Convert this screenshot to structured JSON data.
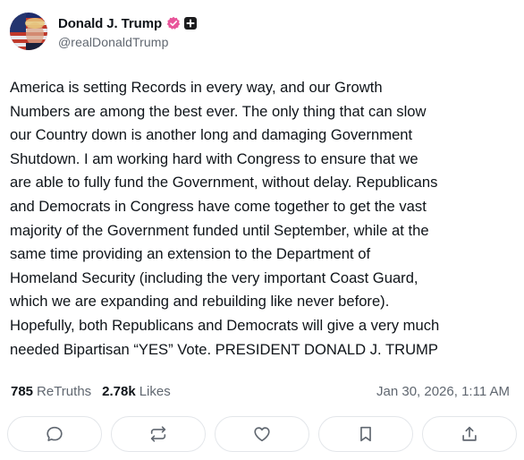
{
  "author": {
    "display_name": "Donald J. Trump",
    "handle": "@realDonaldTrump",
    "verified_color": "#e8559a"
  },
  "post": {
    "text": "America is setting Records in every way, and our Growth\nNumbers are among the best ever. The only thing that can slow\nour Country down is another long and damaging Government\nShutdown. I am working hard with Congress to ensure that we\nare able to fully fund the Government, without delay. Republicans\nand Democrats in Congress have come together to get the vast\nmajority of the Government funded until September, while at the\nsame time providing an extension to the Department of\nHomeland Security (including the very important Coast Guard,\nwhich we are expanding and rebuilding like never before).\nHopefully, both Republicans and Democrats will give a very much\nneeded Bipartisan “YES” Vote. PRESIDENT DONALD J. TRUMP"
  },
  "stats": {
    "retruths_count": "785",
    "retruths_label": "ReTruths",
    "likes_count": "2.78k",
    "likes_label": "Likes",
    "timestamp": "Jan 30, 2026, 1:11 AM"
  },
  "actions": [
    {
      "name": "reply",
      "icon": "comment-icon"
    },
    {
      "name": "retruth",
      "icon": "repost-icon"
    },
    {
      "name": "like",
      "icon": "heart-icon"
    },
    {
      "name": "bookmark",
      "icon": "bookmark-icon"
    },
    {
      "name": "share",
      "icon": "share-icon"
    }
  ],
  "colors": {
    "text": "#0f1419",
    "muted": "#606770",
    "border": "#e3e6ea",
    "verified": "#e8559a"
  }
}
